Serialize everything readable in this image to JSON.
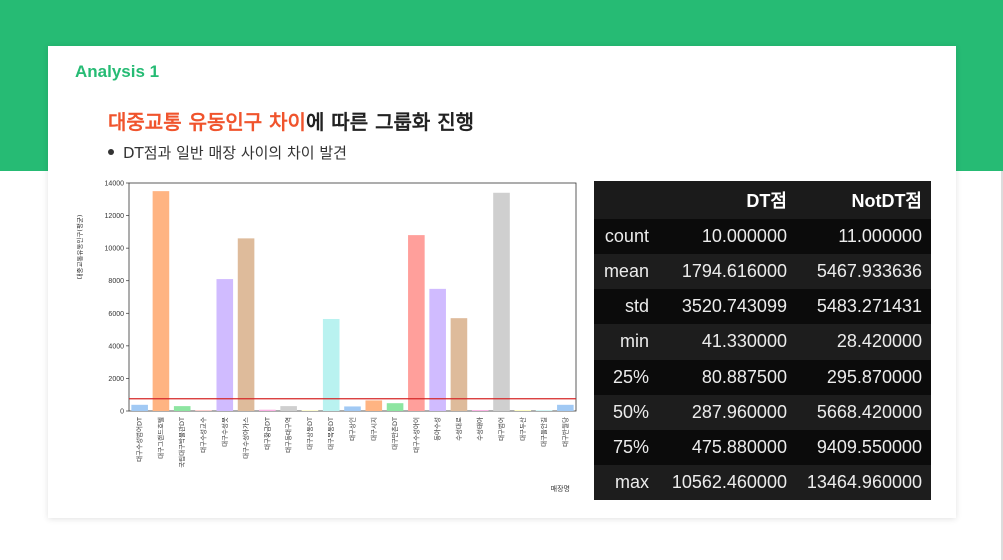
{
  "slide": {
    "section_label": "Analysis 1",
    "headline_highlight": "대중교통 유동인구 차이",
    "headline_rest": "에 따른 그룹화 진행",
    "bullet": "DT점과 일반 매장 사이의 차이 발견"
  },
  "chart_data": {
    "type": "bar",
    "ylabel": "대중교통유동인구(평균)",
    "xlabel": "매장명",
    "ylim": [
      0,
      14000
    ],
    "yticks": [
      0,
      2000,
      4000,
      6000,
      8000,
      10000,
      12000,
      14000
    ],
    "categories": [
      "대구수성범어DT",
      "대구그랜드호텔",
      "국립대구박물관DT",
      "대구수성교수",
      "대구수성못",
      "대구수성아가스",
      "대구황금DT",
      "대구동대구역",
      "대구상동DT",
      "대구목동DT",
      "대구상인",
      "대구시지",
      "대구만촌DT",
      "대구수성아이",
      "동아수성",
      "수성대로",
      "수성태아",
      "대구범어",
      "대구두산",
      "대구들안길",
      "대구반월당"
    ],
    "values": [
      380,
      13500,
      300,
      30,
      8100,
      10600,
      80,
      300,
      30,
      5650,
      280,
      650,
      480,
      10800,
      7500,
      5700,
      60,
      13400,
      40,
      40,
      380
    ],
    "colors": [
      "#a1c9f4",
      "#ffb482",
      "#8de5a1",
      "#ff9f9b",
      "#d0bbff",
      "#debb9b",
      "#fab0e4",
      "#cfcfcf",
      "#fffea3",
      "#b9f2f0",
      "#a1c9f4",
      "#ffb482",
      "#8de5a1",
      "#ff9f9b",
      "#d0bbff",
      "#debb9b",
      "#fab0e4",
      "#cfcfcf",
      "#fffea3",
      "#b9f2f0",
      "#a1c9f4"
    ],
    "reference_line": 750,
    "reference_color": "#d62728"
  },
  "stats_table": {
    "columns": [
      "",
      "DT점",
      "NotDT점"
    ],
    "rows": [
      [
        "count",
        "10.000000",
        "11.000000"
      ],
      [
        "mean",
        "1794.616000",
        "5467.933636"
      ],
      [
        "std",
        "3520.743099",
        "5483.271431"
      ],
      [
        "min",
        "41.330000",
        "28.420000"
      ],
      [
        "25%",
        "80.887500",
        "295.870000"
      ],
      [
        "50%",
        "287.960000",
        "5668.420000"
      ],
      [
        "75%",
        "475.880000",
        "9409.550000"
      ],
      [
        "max",
        "10562.460000",
        "13464.960000"
      ]
    ]
  }
}
